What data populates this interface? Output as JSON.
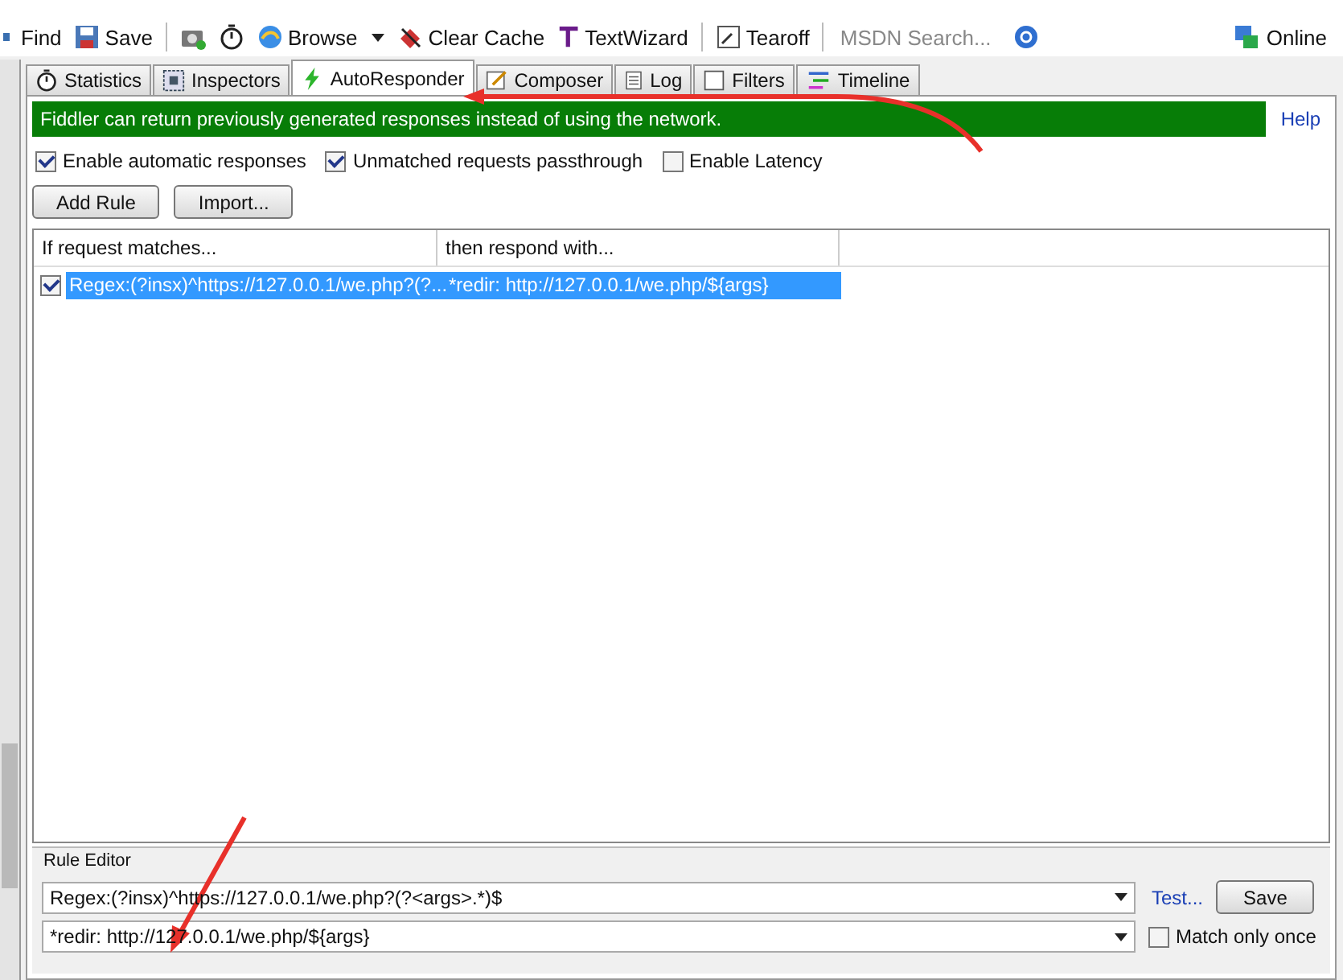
{
  "toolbar": {
    "items": [
      {
        "kind": "find",
        "label": "Find"
      },
      {
        "kind": "save",
        "label": "Save"
      },
      {
        "kind": "camera"
      },
      {
        "kind": "timer"
      },
      {
        "kind": "browse",
        "label": "Browse",
        "dropdown": true
      },
      {
        "kind": "clear",
        "label": "Clear Cache"
      },
      {
        "kind": "textwizard",
        "label": "TextWizard"
      },
      {
        "kind": "tearoff",
        "label": "Tearoff"
      }
    ],
    "search": {
      "placeholder": "MSDN Search..."
    },
    "online": "Online"
  },
  "tabs": [
    {
      "label": "Statistics",
      "selected": false,
      "kind": "timer"
    },
    {
      "label": "Inspectors",
      "selected": false,
      "kind": "grid"
    },
    {
      "label": "AutoResponder",
      "selected": true,
      "kind": "bolt"
    },
    {
      "label": "Composer",
      "selected": false,
      "kind": "pen"
    },
    {
      "label": "Log",
      "selected": false,
      "kind": "doc"
    },
    {
      "label": "Filters",
      "selected": false,
      "kind": "box"
    },
    {
      "label": "Timeline",
      "selected": false,
      "kind": "lines"
    }
  ],
  "banner": {
    "text": "Fiddler can return previously generated responses instead of using the network.",
    "help": "Help"
  },
  "options": [
    {
      "label": "Enable automatic responses",
      "checked": true
    },
    {
      "label": "Unmatched requests passthrough",
      "checked": true
    },
    {
      "label": "Enable Latency",
      "checked": false
    }
  ],
  "buttons": [
    "Add Rule",
    "Import..."
  ],
  "rules": {
    "columns": [
      "If request matches...",
      "then respond with..."
    ],
    "rows": [
      {
        "checked": true,
        "selected": true,
        "match": "Regex:(?insx)^https://127.0.0.1/we.php?(?...",
        "response": "*redir: http://127.0.0.1/we.php/${args}"
      }
    ]
  },
  "rule_editor": {
    "title": "Rule Editor",
    "match_value": "Regex:(?insx)^https://127.0.0.1/we.php?(?<args>.*)$",
    "response_value": "*redir: http://127.0.0.1/we.php/${args}",
    "test_link": "Test...",
    "save": "Save",
    "match_once": {
      "label": "Match only once",
      "checked": false
    }
  }
}
